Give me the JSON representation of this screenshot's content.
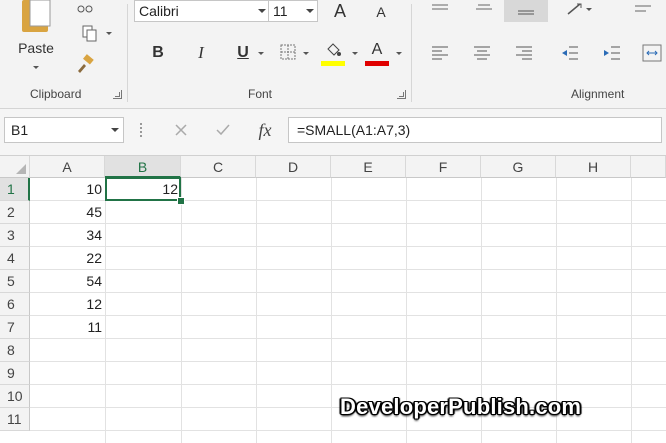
{
  "ribbon": {
    "clipboard": {
      "paste_label": "Paste",
      "group_label": "Clipboard"
    },
    "font": {
      "font_name": "Calibri",
      "font_size": "11",
      "grow_label": "A",
      "shrink_label": "A",
      "bold_label": "B",
      "italic_label": "I",
      "underline_label": "U",
      "font_color_label": "A",
      "highlight_color": "#ffff00",
      "font_color": "#e00000",
      "group_label": "Font"
    },
    "alignment": {
      "group_label": "Alignment"
    }
  },
  "formula_bar": {
    "name_box": "B1",
    "fx_label": "fx",
    "formula": "=SMALL(A1:A7,3)"
  },
  "grid": {
    "columns": [
      "A",
      "B",
      "C",
      "D",
      "E",
      "F",
      "G",
      "H"
    ],
    "selected_column": "B",
    "rows": [
      "1",
      "2",
      "3",
      "4",
      "5",
      "6",
      "7",
      "8",
      "9",
      "10",
      "11"
    ],
    "selected_row": "1",
    "cells": {
      "A1": "10",
      "A2": "45",
      "A3": "34",
      "A4": "22",
      "A5": "54",
      "A6": "12",
      "A7": "11",
      "B1": "12"
    },
    "accent_color": "#217346"
  },
  "watermark": "DeveloperPublish.com"
}
